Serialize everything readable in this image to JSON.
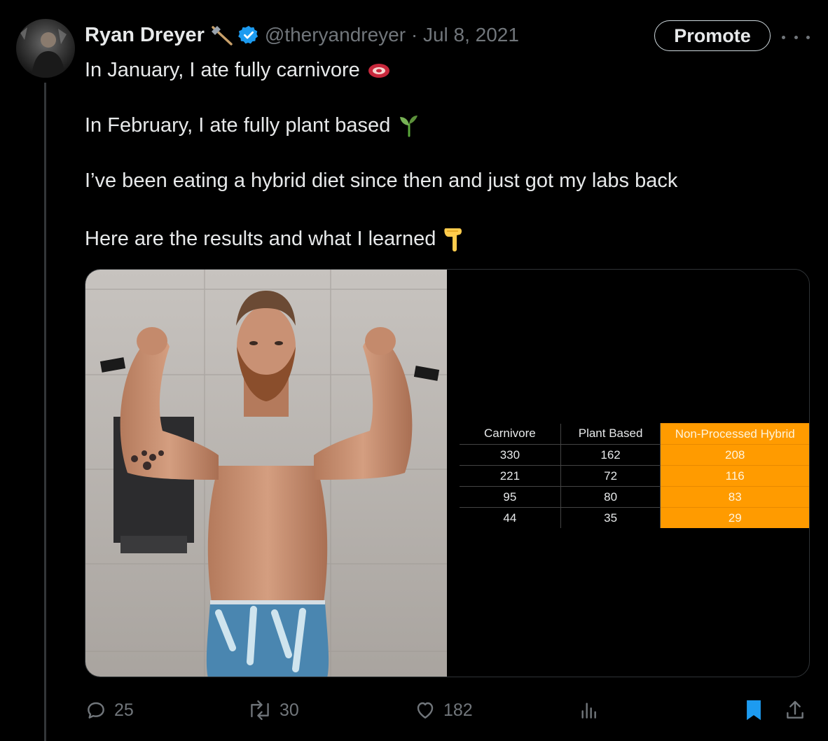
{
  "tweet": {
    "author_name": "Ryan Dreyer",
    "handle_and_date": "@theryandreyer · Jul 8, 2021",
    "promote_label": "Promote",
    "lines": [
      "In January, I ate fully carnivore",
      "In February, I ate fully plant based",
      "I’ve been eating a hybrid diet since then and just got my labs back",
      "Here are the results and what I learned"
    ]
  },
  "media": {
    "table": {
      "headers": [
        "Carnivore",
        "Plant Based",
        "Non-Processed Hybrid"
      ],
      "rows": [
        [
          "330",
          "162",
          "208"
        ],
        [
          "221",
          "72",
          "116"
        ],
        [
          "95",
          "80",
          "83"
        ],
        [
          "44",
          "35",
          "29"
        ]
      ],
      "highlight_color": "#ff9b00"
    }
  },
  "actions": {
    "replies": "25",
    "reposts": "30",
    "likes": "182"
  },
  "icons": {
    "line1_emoji": "meat-icon",
    "line2_emoji": "seedling-icon",
    "line4_emoji": "pointing-down-icon",
    "name_emoji": "axe-icon"
  },
  "colors": {
    "background": "#000000",
    "text": "#e7e9ea",
    "muted": "#71767b",
    "verified": "#1d9bf0",
    "bookmark": "#1d9bf0"
  }
}
